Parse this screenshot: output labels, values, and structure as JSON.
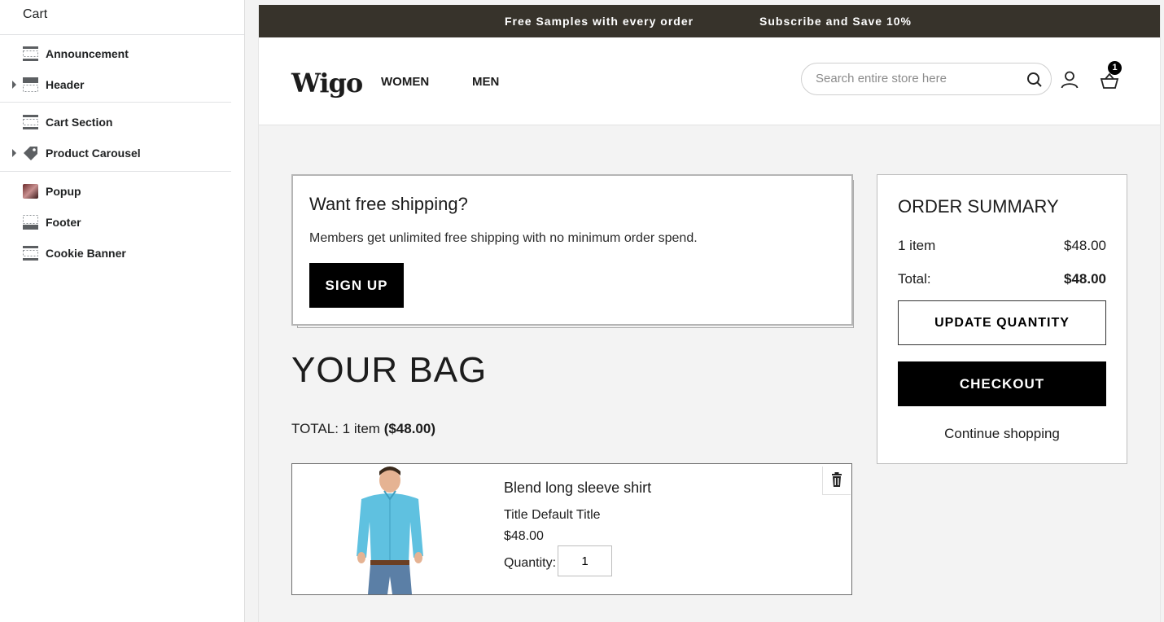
{
  "sidebar": {
    "title": "Cart",
    "items": [
      {
        "label": "Announcement",
        "icon": "section-icon",
        "expandable": false
      },
      {
        "label": "Header",
        "icon": "section-icon",
        "expandable": true
      },
      {
        "label": "Cart Section",
        "icon": "section-icon",
        "expandable": false
      },
      {
        "label": "Product Carousel",
        "icon": "tag-icon",
        "expandable": true
      },
      {
        "label": "Popup",
        "icon": "image-thumbnail",
        "expandable": false
      },
      {
        "label": "Footer",
        "icon": "section-icon",
        "expandable": false
      },
      {
        "label": "Cookie Banner",
        "icon": "section-icon",
        "expandable": false
      }
    ]
  },
  "announcement": {
    "message_1": "Free Samples with every order",
    "message_2": "Subscribe and Save 10%",
    "background": "#37332b"
  },
  "header": {
    "logo": "Wigo",
    "nav": [
      "WOMEN",
      "MEN"
    ],
    "search_placeholder": "Search entire store here",
    "cart_count": "1"
  },
  "shipping_promo": {
    "heading": "Want free shipping?",
    "text": "Members get unlimited free shipping with no minimum order spend.",
    "button": "SIGN UP"
  },
  "bag": {
    "title": "YOUR BAG",
    "total_prefix": "TOTAL: 1 item ",
    "total_amount": "($48.00)"
  },
  "line_item": {
    "name": "Blend long sleeve shirt",
    "variant": "Title Default Title",
    "price": "$48.00",
    "quantity_label": "Quantity:",
    "quantity": "1"
  },
  "summary": {
    "title": "ORDER SUMMARY",
    "items_label": "1 item",
    "items_value": "$48.00",
    "total_label": "Total:",
    "total_value": "$48.00",
    "update_button": "UPDATE QUANTITY",
    "checkout_button": "CHECKOUT",
    "continue_link": "Continue shopping"
  }
}
